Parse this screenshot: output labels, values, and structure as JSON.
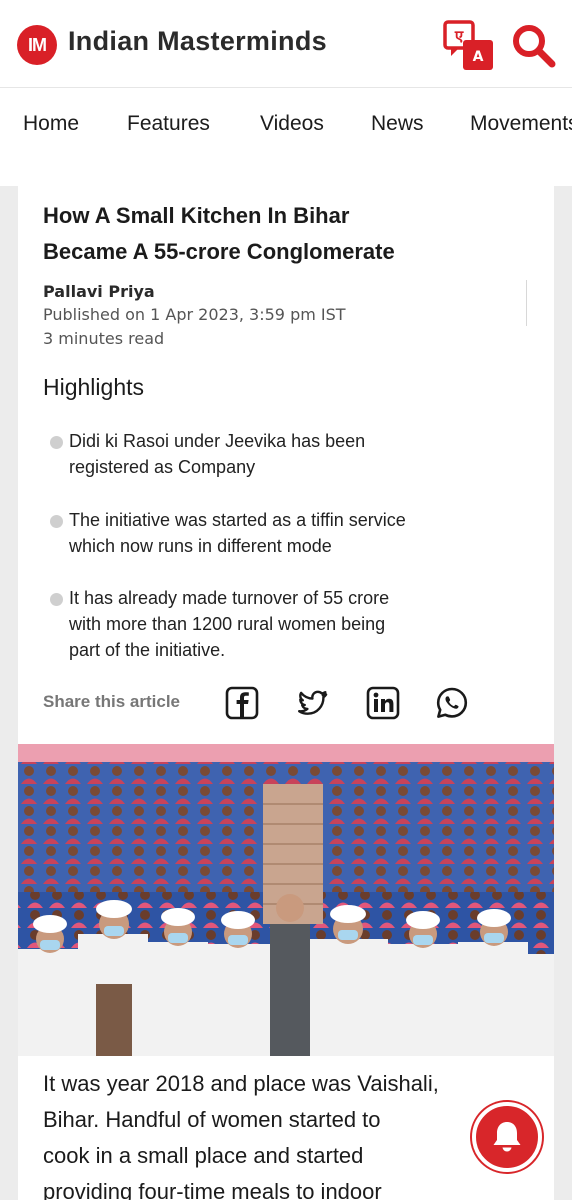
{
  "header": {
    "logo_initials": "IM",
    "site_name": "Indian Masterminds",
    "translate_glyph_top": "ए",
    "translate_glyph_bottom": "A"
  },
  "nav": {
    "items": [
      "Home",
      "Features",
      "Videos",
      "News",
      "Movements"
    ]
  },
  "article": {
    "title_line1": "How A Small Kitchen In Bihar",
    "title_line2": "Became A 55-crore Conglomerate",
    "author": "Pallavi Priya",
    "published": "Published on 1 Apr 2023, 3:59 pm IST",
    "read_time": "3 minutes read",
    "highlights_heading": "Highlights",
    "highlights": [
      {
        "line1": "Didi ki Rasoi under Jeevika has been",
        "line2": "registered as Company",
        "line3": ""
      },
      {
        "line1": "The initiative was started as a tiffin service",
        "line2": "which now runs in different mode",
        "line3": ""
      },
      {
        "line1": "It has already made turnover of 55 crore",
        "line2": "with more than 1200 rural women being",
        "line3": "part of the initiative."
      }
    ],
    "share_label": "Share this article",
    "share_icons": [
      "facebook-icon",
      "twitter-icon",
      "linkedin-icon",
      "whatsapp-icon"
    ],
    "body_lines": [
      "It was year 2018 and place was Vaishali,",
      "Bihar. Handful of women started to",
      "cook in a small place and started",
      "providing four-time meals to indoor"
    ]
  },
  "colors": {
    "brand_red": "#d92027",
    "page_bg": "#ececec"
  }
}
